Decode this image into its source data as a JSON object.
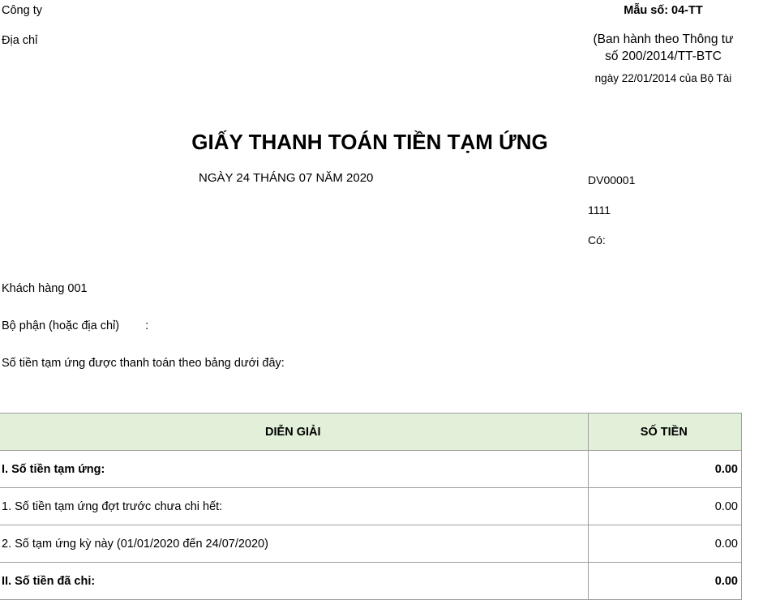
{
  "header": {
    "company_label": "Công ty",
    "address_label": "Địa chỉ",
    "form_code": "Mẫu số: 04-TT",
    "issued_line1": "(Ban hành theo Thông tư",
    "issued_line2": "số 200/2014/TT-BTC",
    "issued_line3": "ngày 22/01/2014 của Bộ Tài"
  },
  "document": {
    "title": "GIẤY THANH TOÁN TIỀN TẠM ỨNG",
    "date": "NGÀY 24 THÁNG 07 NĂM 2020",
    "number": "DV00001",
    "debit_account": "1111",
    "credit_label": "Có:"
  },
  "info": {
    "customer": "Khách hàng 001",
    "department_label": "Bộ phận (hoặc địa chỉ)",
    "department_colon": ":",
    "intro": "Số tiền tạm ứng được thanh toán theo bảng dưới đây:"
  },
  "table": {
    "headers": [
      "DIỄN GIẢI",
      "SỐ TIỀN"
    ],
    "rows": [
      {
        "description": "I. Số tiền tạm ứng:",
        "amount": "0.00",
        "bold": true
      },
      {
        "description": "1. Số tiền tạm ứng đợt trước chưa chi hết:",
        "amount": "0.00",
        "bold": false
      },
      {
        "description": "2. Số tạm ứng kỳ này (01/01/2020 đến 24/07/2020)",
        "amount": "0.00",
        "bold": false
      },
      {
        "description": "II. Số tiền đã chi:",
        "amount": "0.00",
        "bold": true
      }
    ]
  },
  "colors": {
    "header_background": "#e2f0d9",
    "grid_line": "#9e9e9e"
  }
}
